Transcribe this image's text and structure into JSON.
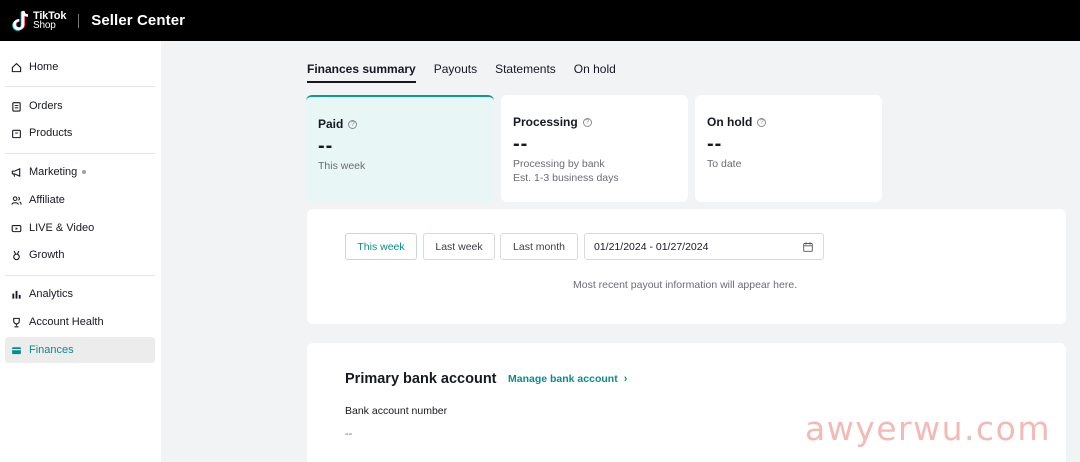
{
  "header": {
    "logo_line1": "TikTok",
    "logo_line2": "Shop",
    "title": "Seller Center"
  },
  "sidebar": {
    "items": [
      {
        "label": "Home",
        "icon": "home-icon"
      },
      {
        "label": "Orders",
        "icon": "clipboard-icon"
      },
      {
        "label": "Products",
        "icon": "box-icon"
      },
      {
        "label": "Marketing",
        "icon": "megaphone-icon"
      },
      {
        "label": "Affiliate",
        "icon": "people-icon"
      },
      {
        "label": "LIVE & Video",
        "icon": "video-icon"
      },
      {
        "label": "Growth",
        "icon": "medal-icon"
      },
      {
        "label": "Analytics",
        "icon": "bar-chart-icon"
      },
      {
        "label": "Account Health",
        "icon": "trophy-icon"
      },
      {
        "label": "Finances",
        "icon": "wallet-icon",
        "active": true
      }
    ]
  },
  "tabs": [
    {
      "label": "Finances summary",
      "active": true
    },
    {
      "label": "Payouts"
    },
    {
      "label": "Statements"
    },
    {
      "label": "On hold"
    }
  ],
  "cards": {
    "paid": {
      "title": "Paid",
      "value": "--",
      "sub1": "This week"
    },
    "processing": {
      "title": "Processing",
      "value": "--",
      "sub1": "Processing by bank",
      "sub2": "Est. 1-3 business days"
    },
    "onhold": {
      "title": "On hold",
      "value": "--",
      "sub1": "To date"
    }
  },
  "filters": {
    "this_week": "This week",
    "last_week": "Last week",
    "last_month": "Last month",
    "date_range": "01/21/2024 - 01/27/2024",
    "empty_message": "Most recent payout information will appear here."
  },
  "bank": {
    "title": "Primary bank account",
    "manage_link": "Manage bank account",
    "number_label": "Bank account number",
    "number_value": "--"
  },
  "watermark": "awyerwu.com",
  "colors": {
    "accent": "#0a8d8a",
    "topbar": "#000000",
    "paid_card_bg": "#e8f6f5"
  }
}
